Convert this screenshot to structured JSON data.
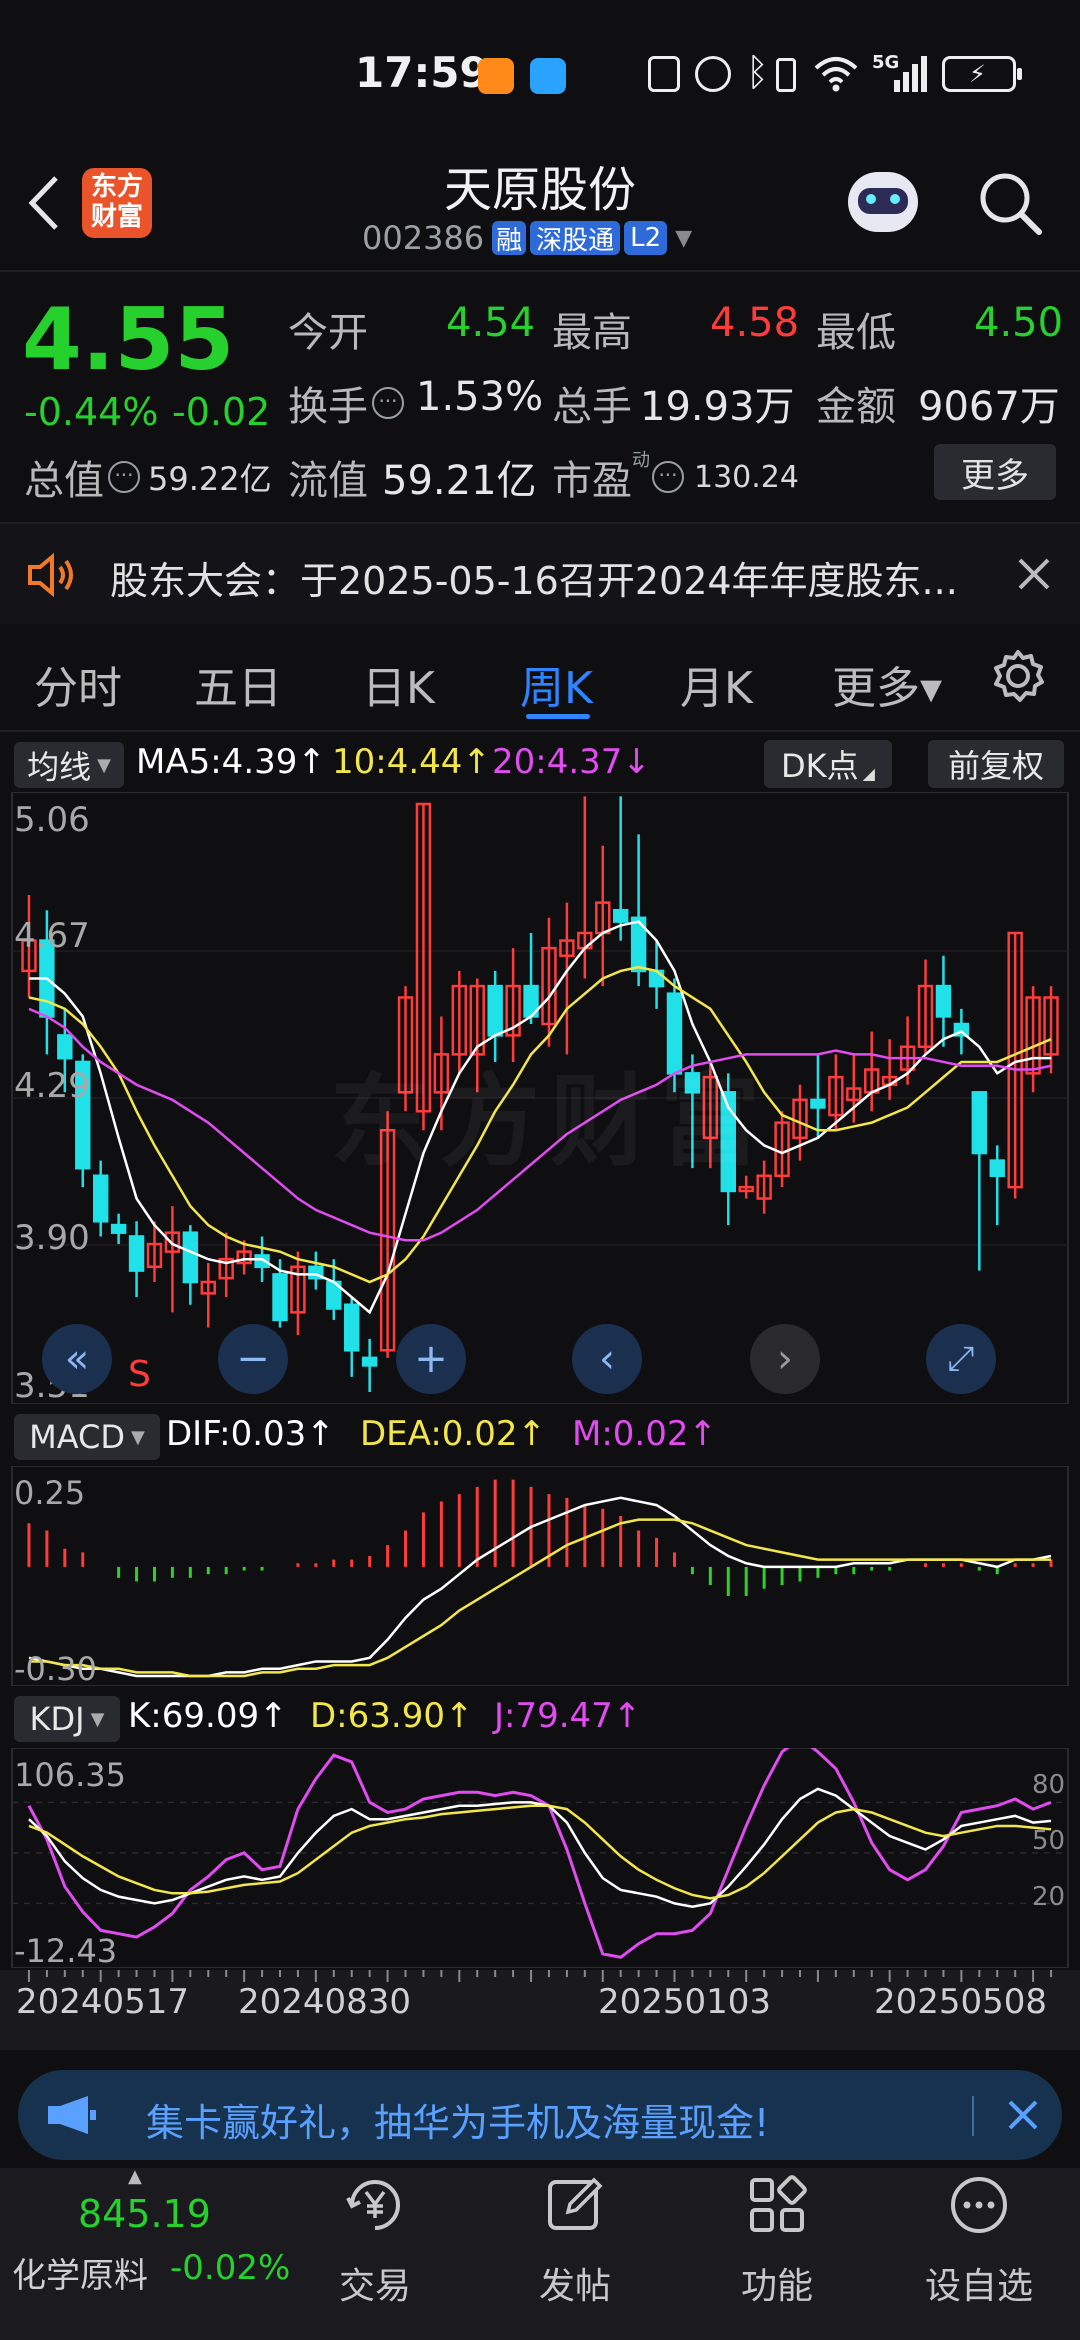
{
  "status_bar": {
    "time": "17:59",
    "icons": [
      "nfc-icon",
      "alarm-icon",
      "bluetooth-icon",
      "vibrate-icon",
      "wifi-icon",
      "signal-5g-icon",
      "battery-charging-icon"
    ],
    "network_label": "5G"
  },
  "header": {
    "logo_text_line1": "东方",
    "logo_text_line2": "财富",
    "title": "天原股份",
    "code": "002386",
    "badges": [
      "融",
      "深股通",
      "L2"
    ]
  },
  "quote": {
    "price": "4.55",
    "change_pct": "-0.44%",
    "change": "-0.02",
    "open_label": "今开",
    "open": "4.54",
    "high_label": "最高",
    "high": "4.58",
    "low_label": "最低",
    "low": "4.50",
    "turnover_label": "换手",
    "turnover": "1.53%",
    "volume_label": "总手",
    "volume": "19.93万",
    "amount_label": "金额",
    "amount": "9067万",
    "total_cap_label": "总值",
    "total_cap": "59.22亿",
    "float_cap_label": "流值",
    "float_cap": "59.21亿",
    "pe_label": "市盈",
    "pe_superscript": "动",
    "pe": "130.24",
    "more_label": "更多"
  },
  "notice": {
    "text": "股东大会：于2025-05-16召开2024年年度股东..."
  },
  "tabs": [
    {
      "label": "分时"
    },
    {
      "label": "五日"
    },
    {
      "label": "日K"
    },
    {
      "label": "周K",
      "active": true
    },
    {
      "label": "月K"
    },
    {
      "label": "更多▾"
    }
  ],
  "ma_bar": {
    "selector": "均线",
    "ma5": "MA5:4.39↑",
    "ma10": "10:4.44↑",
    "ma20": "20:4.37↓",
    "dk_label": "DK点",
    "adjust_label": "前复权"
  },
  "price_axis": [
    "5.06",
    "4.67",
    "4.29",
    "3.90",
    "3.51"
  ],
  "sell_marker": "S",
  "macd_bar": {
    "selector": "MACD",
    "dif": "DIF:0.03↑",
    "dea": "DEA:0.02↑",
    "m": "M:0.02↑"
  },
  "macd_axis": [
    "0.25",
    "-0.30"
  ],
  "kdj_bar": {
    "selector": "KDJ",
    "k": "K:69.09↑",
    "d": "D:63.90↑",
    "j": "J:79.47↑"
  },
  "kdj_axis": [
    "106.35",
    "-12.43"
  ],
  "kdj_right_axis": [
    "80",
    "50",
    "20"
  ],
  "date_axis": [
    "20240517",
    "20240830",
    "20250103",
    "20250508"
  ],
  "watermark": "东方财富",
  "promo": {
    "text": "集卡赢好礼，抽华为手机及海量现金!"
  },
  "bottom_bar": {
    "index_value": "845.19",
    "index_name": "化学原料",
    "index_change": "-0.02%",
    "items": [
      {
        "label": "交易",
        "icon": "yen-trade-icon"
      },
      {
        "label": "发帖",
        "icon": "edit-post-icon"
      },
      {
        "label": "功能",
        "icon": "grid-function-icon"
      },
      {
        "label": "设自选",
        "icon": "more-dots-icon"
      }
    ]
  },
  "colors": {
    "up": "#ff3b3b",
    "down": "#20e0e8",
    "accent": "#2f84ff",
    "ma5": "#ffffff",
    "ma10": "#f2e64a",
    "ma20": "#e04cf0"
  },
  "chart_data": {
    "type": "candlestick",
    "title": "",
    "y_range": [
      3.51,
      5.06
    ],
    "candles": [
      {
        "o": 4.62,
        "c": 4.7,
        "h": 4.82,
        "l": 4.55
      },
      {
        "o": 4.7,
        "c": 4.5,
        "h": 4.78,
        "l": 4.4
      },
      {
        "o": 4.45,
        "c": 4.39,
        "h": 4.52,
        "l": 4.3
      },
      {
        "o": 4.38,
        "c": 4.1,
        "h": 4.4,
        "l": 4.05
      },
      {
        "o": 4.08,
        "c": 3.96,
        "h": 4.12,
        "l": 3.92
      },
      {
        "o": 3.95,
        "c": 3.93,
        "h": 3.98,
        "l": 3.9
      },
      {
        "o": 3.92,
        "c": 3.83,
        "h": 3.96,
        "l": 3.76
      },
      {
        "o": 3.84,
        "c": 3.9,
        "h": 3.96,
        "l": 3.8
      },
      {
        "o": 3.88,
        "c": 3.93,
        "h": 4.0,
        "l": 3.72
      },
      {
        "o": 3.93,
        "c": 3.8,
        "h": 3.95,
        "l": 3.74
      },
      {
        "o": 3.77,
        "c": 3.8,
        "h": 3.85,
        "l": 3.68
      },
      {
        "o": 3.81,
        "c": 3.86,
        "h": 3.93,
        "l": 3.76
      },
      {
        "o": 3.85,
        "c": 3.88,
        "h": 3.91,
        "l": 3.82
      },
      {
        "o": 3.87,
        "c": 3.84,
        "h": 3.92,
        "l": 3.8
      },
      {
        "o": 3.82,
        "c": 3.7,
        "h": 3.86,
        "l": 3.68
      },
      {
        "o": 3.72,
        "c": 3.84,
        "h": 3.88,
        "l": 3.66
      },
      {
        "o": 3.84,
        "c": 3.81,
        "h": 3.88,
        "l": 3.78
      },
      {
        "o": 3.8,
        "c": 3.73,
        "h": 3.86,
        "l": 3.7
      },
      {
        "o": 3.74,
        "c": 3.62,
        "h": 3.76,
        "l": 3.55
      },
      {
        "o": 3.6,
        "c": 3.58,
        "h": 3.65,
        "l": 3.51
      },
      {
        "o": 3.62,
        "c": 4.2,
        "h": 4.25,
        "l": 3.6
      },
      {
        "o": 4.3,
        "c": 4.55,
        "h": 4.58,
        "l": 4.25
      },
      {
        "o": 4.25,
        "c": 5.06,
        "h": 5.06,
        "l": 4.2
      },
      {
        "o": 4.3,
        "c": 4.4,
        "h": 4.5,
        "l": 4.2
      },
      {
        "o": 4.4,
        "c": 4.58,
        "h": 4.62,
        "l": 4.35
      },
      {
        "o": 4.4,
        "c": 4.58,
        "h": 4.6,
        "l": 4.3
      },
      {
        "o": 4.58,
        "c": 4.45,
        "h": 4.62,
        "l": 4.38
      },
      {
        "o": 4.45,
        "c": 4.58,
        "h": 4.68,
        "l": 4.38
      },
      {
        "o": 4.58,
        "c": 4.5,
        "h": 4.72,
        "l": 4.48
      },
      {
        "o": 4.48,
        "c": 4.68,
        "h": 4.76,
        "l": 4.42
      },
      {
        "o": 4.66,
        "c": 4.7,
        "h": 4.8,
        "l": 4.4
      },
      {
        "o": 4.68,
        "c": 4.72,
        "h": 5.08,
        "l": 4.6
      },
      {
        "o": 4.72,
        "c": 4.8,
        "h": 4.95,
        "l": 4.58
      },
      {
        "o": 4.78,
        "c": 4.75,
        "h": 5.08,
        "l": 4.7
      },
      {
        "o": 4.76,
        "c": 4.62,
        "h": 4.98,
        "l": 4.58
      },
      {
        "o": 4.62,
        "c": 4.58,
        "h": 4.7,
        "l": 4.52
      },
      {
        "o": 4.56,
        "c": 4.35,
        "h": 4.6,
        "l": 4.3
      },
      {
        "o": 4.35,
        "c": 4.3,
        "h": 4.4,
        "l": 4.1
      },
      {
        "o": 4.18,
        "c": 4.34,
        "h": 4.38,
        "l": 4.1
      },
      {
        "o": 4.3,
        "c": 4.04,
        "h": 4.35,
        "l": 3.95
      },
      {
        "o": 4.04,
        "c": 4.05,
        "h": 4.08,
        "l": 4.02
      },
      {
        "o": 4.02,
        "c": 4.08,
        "h": 4.12,
        "l": 3.98
      },
      {
        "o": 4.08,
        "c": 4.22,
        "h": 4.25,
        "l": 4.05
      },
      {
        "o": 4.18,
        "c": 4.28,
        "h": 4.32,
        "l": 4.12
      },
      {
        "o": 4.28,
        "c": 4.26,
        "h": 4.4,
        "l": 4.18
      },
      {
        "o": 4.24,
        "c": 4.34,
        "h": 4.4,
        "l": 4.2
      },
      {
        "o": 4.28,
        "c": 4.31,
        "h": 4.4,
        "l": 4.22
      },
      {
        "o": 4.3,
        "c": 4.36,
        "h": 4.46,
        "l": 4.25
      },
      {
        "o": 4.32,
        "c": 4.34,
        "h": 4.44,
        "l": 4.28
      },
      {
        "o": 4.36,
        "c": 4.42,
        "h": 4.5,
        "l": 4.32
      },
      {
        "o": 4.42,
        "c": 4.58,
        "h": 4.65,
        "l": 4.4
      },
      {
        "o": 4.58,
        "c": 4.5,
        "h": 4.66,
        "l": 4.42
      },
      {
        "o": 4.48,
        "c": 4.45,
        "h": 4.52,
        "l": 4.4
      },
      {
        "o": 4.3,
        "c": 4.14,
        "h": 4.3,
        "l": 3.83
      },
      {
        "o": 4.12,
        "c": 4.08,
        "h": 4.16,
        "l": 3.95
      },
      {
        "o": 4.05,
        "c": 4.72,
        "h": 4.72,
        "l": 4.02
      },
      {
        "o": 4.35,
        "c": 4.55,
        "h": 4.58,
        "l": 4.3
      },
      {
        "o": 4.4,
        "c": 4.55,
        "h": 4.58,
        "l": 4.35
      }
    ],
    "ma5": [
      4.6,
      4.6,
      4.56,
      4.5,
      4.35,
      4.18,
      4.02,
      3.95,
      3.9,
      3.88,
      3.86,
      3.85,
      3.86,
      3.86,
      3.83,
      3.82,
      3.82,
      3.8,
      3.76,
      3.72,
      3.82,
      3.98,
      4.14,
      4.25,
      4.35,
      4.42,
      4.45,
      4.47,
      4.5,
      4.55,
      4.62,
      4.68,
      4.72,
      4.74,
      4.75,
      4.7,
      4.62,
      4.48,
      4.38,
      4.26,
      4.2,
      4.16,
      4.14,
      4.16,
      4.18,
      4.22,
      4.26,
      4.3,
      4.32,
      4.35,
      4.4,
      4.44,
      4.46,
      4.42,
      4.35,
      4.38,
      4.39,
      4.39
    ],
    "ma10": [
      4.55,
      4.54,
      4.52,
      4.48,
      4.42,
      4.35,
      4.25,
      4.16,
      4.08,
      4.0,
      3.95,
      3.92,
      3.9,
      3.89,
      3.88,
      3.86,
      3.85,
      3.84,
      3.82,
      3.8,
      3.82,
      3.86,
      3.92,
      4.0,
      4.08,
      4.16,
      4.25,
      4.32,
      4.4,
      4.45,
      4.52,
      4.56,
      4.6,
      4.62,
      4.63,
      4.62,
      4.58,
      4.55,
      4.52,
      4.45,
      4.38,
      4.3,
      4.24,
      4.22,
      4.2,
      4.2,
      4.21,
      4.22,
      4.24,
      4.26,
      4.3,
      4.34,
      4.38,
      4.38,
      4.38,
      4.4,
      4.42,
      4.44
    ],
    "ma20": [
      4.52,
      4.5,
      4.47,
      4.42,
      4.38,
      4.35,
      4.32,
      4.3,
      4.28,
      4.25,
      4.22,
      4.18,
      4.14,
      4.1,
      4.06,
      4.02,
      3.99,
      3.97,
      3.95,
      3.93,
      3.92,
      3.91,
      3.91,
      3.93,
      3.96,
      3.99,
      4.03,
      4.07,
      4.11,
      4.15,
      4.19,
      4.22,
      4.25,
      4.28,
      4.3,
      4.32,
      4.35,
      4.37,
      4.38,
      4.39,
      4.4,
      4.4,
      4.4,
      4.4,
      4.4,
      4.41,
      4.4,
      4.4,
      4.39,
      4.39,
      4.39,
      4.38,
      4.37,
      4.37,
      4.37,
      4.36,
      4.36,
      4.37
    ]
  },
  "macd_data": {
    "y_range": [
      -0.3,
      0.25
    ],
    "hist": [
      0.12,
      0.1,
      0.05,
      0.04,
      0.0,
      -0.03,
      -0.04,
      -0.04,
      -0.03,
      -0.03,
      -0.02,
      -0.02,
      -0.01,
      -0.01,
      0.0,
      0.01,
      0.01,
      0.02,
      0.02,
      0.03,
      0.06,
      0.1,
      0.15,
      0.18,
      0.2,
      0.22,
      0.24,
      0.24,
      0.22,
      0.2,
      0.19,
      0.17,
      0.16,
      0.14,
      0.1,
      0.08,
      0.04,
      -0.02,
      -0.05,
      -0.08,
      -0.08,
      -0.06,
      -0.05,
      -0.04,
      -0.03,
      -0.02,
      -0.02,
      -0.01,
      -0.01,
      0.0,
      0.01,
      0.01,
      0.01,
      -0.01,
      -0.02,
      0.01,
      0.01,
      0.02
    ],
    "dif": [
      -0.25,
      -0.26,
      -0.27,
      -0.28,
      -0.28,
      -0.29,
      -0.3,
      -0.3,
      -0.3,
      -0.3,
      -0.3,
      -0.29,
      -0.29,
      -0.28,
      -0.28,
      -0.27,
      -0.26,
      -0.26,
      -0.26,
      -0.25,
      -0.2,
      -0.14,
      -0.09,
      -0.06,
      -0.02,
      0.02,
      0.05,
      0.08,
      0.11,
      0.13,
      0.15,
      0.17,
      0.18,
      0.19,
      0.18,
      0.17,
      0.14,
      0.1,
      0.06,
      0.03,
      0.01,
      0.0,
      0.0,
      0.0,
      0.0,
      0.0,
      0.01,
      0.01,
      0.01,
      0.02,
      0.02,
      0.02,
      0.02,
      0.01,
      0.0,
      0.02,
      0.02,
      0.03
    ],
    "dea": [
      -0.26,
      -0.26,
      -0.27,
      -0.27,
      -0.28,
      -0.28,
      -0.29,
      -0.29,
      -0.29,
      -0.3,
      -0.3,
      -0.3,
      -0.3,
      -0.29,
      -0.29,
      -0.28,
      -0.28,
      -0.27,
      -0.27,
      -0.27,
      -0.25,
      -0.22,
      -0.19,
      -0.16,
      -0.12,
      -0.09,
      -0.06,
      -0.03,
      0.0,
      0.03,
      0.06,
      0.08,
      0.1,
      0.12,
      0.13,
      0.13,
      0.13,
      0.12,
      0.1,
      0.08,
      0.06,
      0.05,
      0.04,
      0.03,
      0.02,
      0.02,
      0.02,
      0.02,
      0.02,
      0.02,
      0.02,
      0.02,
      0.02,
      0.02,
      0.02,
      0.02,
      0.02,
      0.02
    ]
  },
  "kdj_data": {
    "y_range": [
      -12.43,
      106.35
    ],
    "k": [
      70,
      60,
      45,
      35,
      28,
      24,
      22,
      20,
      22,
      26,
      30,
      34,
      36,
      34,
      36,
      50,
      62,
      72,
      76,
      70,
      70,
      72,
      74,
      76,
      78,
      78,
      79,
      80,
      80,
      78,
      68,
      50,
      35,
      28,
      26,
      24,
      20,
      18,
      20,
      30,
      42,
      55,
      70,
      82,
      88,
      84,
      76,
      68,
      60,
      56,
      52,
      58,
      66,
      68,
      70,
      72,
      68,
      69
    ],
    "d": [
      66,
      62,
      55,
      48,
      42,
      36,
      32,
      28,
      26,
      26,
      27,
      29,
      31,
      32,
      33,
      38,
      46,
      54,
      62,
      66,
      68,
      70,
      71,
      73,
      74,
      75,
      76,
      77,
      78,
      78,
      76,
      68,
      58,
      48,
      40,
      34,
      29,
      25,
      23,
      25,
      30,
      38,
      48,
      58,
      68,
      74,
      76,
      74,
      70,
      66,
      62,
      60,
      62,
      64,
      66,
      66,
      65,
      64
    ],
    "j": [
      78,
      58,
      30,
      15,
      4,
      2,
      0,
      6,
      14,
      28,
      36,
      46,
      50,
      40,
      42,
      76,
      94,
      108,
      104,
      80,
      74,
      76,
      82,
      84,
      86,
      86,
      84,
      86,
      84,
      78,
      52,
      20,
      -10,
      -12,
      -4,
      2,
      2,
      4,
      14,
      40,
      66,
      90,
      110,
      118,
      110,
      100,
      80,
      56,
      40,
      34,
      40,
      54,
      74,
      76,
      78,
      82,
      76,
      80
    ]
  }
}
